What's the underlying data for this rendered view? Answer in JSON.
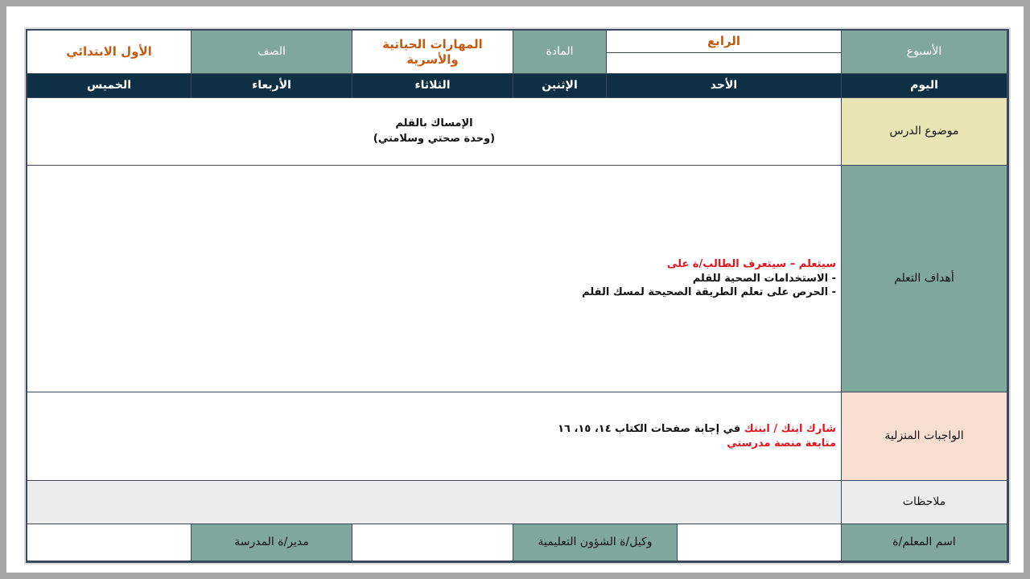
{
  "header": {
    "week_label": "الأسبوع",
    "week_value": "الرابع",
    "subject_label": "المادة",
    "subject_value": "المهارات الحياتية والأسرية",
    "grade_label": "الصف",
    "grade_value": "الأول الابتدائي"
  },
  "days": {
    "label": "اليوم",
    "items": [
      "الأحد",
      "الإثنين",
      "الثلاثاء",
      "الأربعاء",
      "الخميس"
    ]
  },
  "lesson": {
    "label": "موضوع الدرس",
    "line1": "الإمساك بالقلم",
    "line2": "(وحدة صحتي وسلامتي)"
  },
  "objectives": {
    "label": "أهداف التعلم",
    "intro": "سيتعلم – سيتعرف الطالب/ة على",
    "items": [
      "- الاستخدامات الصحية للقلم",
      "- الحرص على تعلم الطريقة الصحيحة لمسك القلم"
    ]
  },
  "homework": {
    "label": "الواجبات المنزلية",
    "lead_red": "شارك ابنك / ابنتك",
    "lead_rest": "في إجابة صفحات الكتاب ١٤، ١٥، ١٦",
    "line2": "متابعة منصة مدرستي"
  },
  "notes": {
    "label": "ملاحظات"
  },
  "footer": {
    "teacher_label": "اسم المعلم/ة",
    "deputy_label": "وكيل/ة الشؤون التعليمية",
    "principal_label": "مدير/ة المدرسة"
  },
  "colors": {
    "teal": "#7fa79c",
    "navy": "#0e2f44",
    "orange": "#c55a11",
    "red": "#e3141e",
    "yellow": "#e8e4b4",
    "peach": "#f8ded1",
    "grey": "#ececec"
  }
}
